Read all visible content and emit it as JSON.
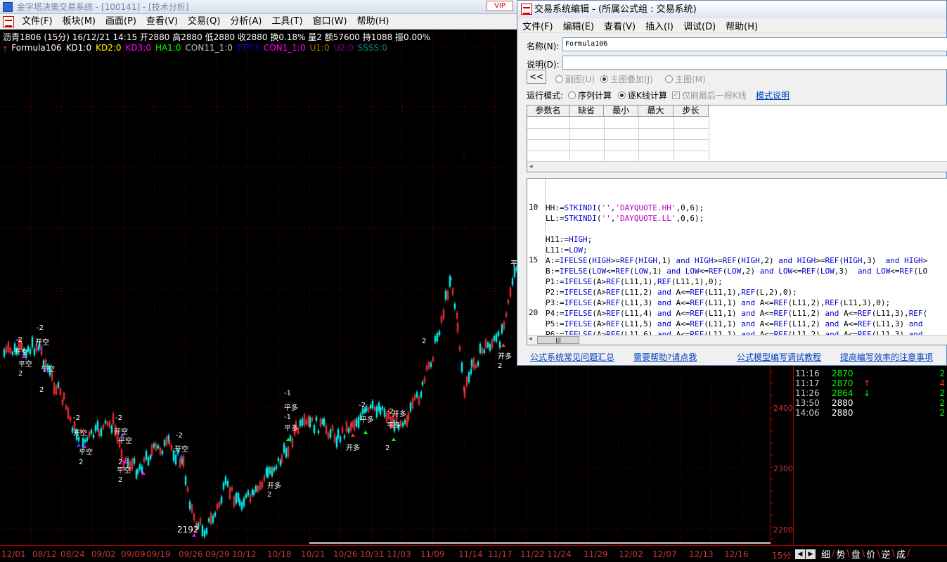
{
  "main_window": {
    "title": "金字塔决策交易系统 - [100141] - [技术分析]",
    "vip_badge": "VIP",
    "menu": [
      "文件(F)",
      "板块(M)",
      "画面(P)",
      "查看(V)",
      "交易(Q)",
      "分析(A)",
      "工具(T)",
      "窗口(W)",
      "帮助(H)"
    ]
  },
  "quote_info": "沥青1806 (15分) 16/12/21 14:15 开2880 高2880 低2880 收2880 换0.18% 量2 额57600 持1088 振0.00%",
  "indicator_bar": [
    {
      "text": "Formula106",
      "color": "#ffffff"
    },
    {
      "text": "KD1:0",
      "color": "#ffffff"
    },
    {
      "text": "KD2:0",
      "color": "#ffff00"
    },
    {
      "text": "KD3:0",
      "color": "#ff00ff"
    },
    {
      "text": "HA1:0",
      "color": "#00ff00"
    },
    {
      "text": "CON11_1:0",
      "color": "#c0c0c0"
    },
    {
      "text": "TTT:3",
      "color": "#0000ff"
    },
    {
      "text": "CON1_1:0",
      "color": "#ff00ff"
    },
    {
      "text": "U1:0",
      "color": "#808000"
    },
    {
      "text": "U2:0",
      "color": "#800080"
    },
    {
      "text": "SSSS:0",
      "color": "#008080"
    }
  ],
  "price_axis": [
    "2400",
    "2300",
    "2200"
  ],
  "date_axis": [
    "12/01",
    "08/12",
    "08/24",
    "09/02",
    "09/09",
    "09/19",
    "09/26",
    "09/29",
    "10/12",
    "10/18",
    "10/21",
    "10/26",
    "10/31",
    "11/03",
    "11/09",
    "11/14",
    "11/17",
    "11/22",
    "11/24",
    "11/29",
    "12/02",
    "12/07",
    "12/13",
    "12/16",
    "15分"
  ],
  "low_marker": "2192",
  "chart_annotations": [
    {
      "text": "-2",
      "color": "#ffffff"
    },
    {
      "text": "开空",
      "color": "#ffffff"
    },
    {
      "text": "平空",
      "color": "#ffffff"
    },
    {
      "text": "2",
      "color": "#ffffff"
    },
    {
      "text": "-2",
      "color": "#ffffff"
    },
    {
      "text": "开空",
      "color": "#ffffff"
    },
    {
      "text": "平空",
      "color": "#ffffff"
    },
    {
      "text": "2",
      "color": "#ffffff"
    },
    {
      "text": "-2",
      "color": "#ffffff"
    },
    {
      "text": "开空",
      "color": "#ffffff"
    },
    {
      "text": "平空",
      "color": "#ffffff"
    },
    {
      "text": "2",
      "color": "#ffffff"
    },
    {
      "text": "-2",
      "color": "#ffffff"
    },
    {
      "text": "开空",
      "color": "#ffffff"
    },
    {
      "text": "平空",
      "color": "#ffffff"
    },
    {
      "text": "2",
      "color": "#ffffff"
    },
    {
      "text": "平空",
      "color": "#ffffff"
    },
    {
      "text": "2",
      "color": "#ffffff"
    },
    {
      "text": "-2",
      "color": "#ffffff"
    },
    {
      "text": "开空",
      "color": "#ffffff"
    },
    {
      "text": "开多",
      "color": "#ffffff"
    },
    {
      "text": "2",
      "color": "#ffffff"
    },
    {
      "text": "-1",
      "color": "#ffffff"
    },
    {
      "text": "平多",
      "color": "#ffffff"
    },
    {
      "text": "-1",
      "color": "#ffffff"
    },
    {
      "text": "平多",
      "color": "#ffffff"
    },
    {
      "text": "开多",
      "color": "#ffffff"
    },
    {
      "text": "-2",
      "color": "#ffffff"
    },
    {
      "text": "平多",
      "color": "#ffffff"
    },
    {
      "text": "-2",
      "color": "#ffffff"
    },
    {
      "text": "平多",
      "color": "#ffffff"
    },
    {
      "text": "2",
      "color": "#ffffff"
    },
    {
      "text": "开多",
      "color": "#ffffff"
    },
    {
      "text": "2",
      "color": "#ffffff"
    },
    {
      "text": "开多",
      "color": "#ffffff"
    },
    {
      "text": "2",
      "color": "#ffffff"
    },
    {
      "text": "平",
      "color": "#ffffff"
    }
  ],
  "ticks": [
    {
      "time": "11:16",
      "price": "2870",
      "arrow": "",
      "vol": "2",
      "price_color": "#00ff00",
      "arrow_color": "#ffffff",
      "vol_color": "#00ff00"
    },
    {
      "time": "11:17",
      "price": "2870",
      "arrow": "↑",
      "vol": "4",
      "price_color": "#00ff00",
      "arrow_color": "#ff3333",
      "vol_color": "#ff3333"
    },
    {
      "time": "11:26",
      "price": "2864",
      "arrow": "↓",
      "vol": "2",
      "price_color": "#00ff00",
      "arrow_color": "#00ff00",
      "vol_color": "#00ff00"
    },
    {
      "time": "13:50",
      "price": "2880",
      "arrow": "",
      "vol": "2",
      "price_color": "#ffffff",
      "arrow_color": "#ffffff",
      "vol_color": "#00ff00"
    },
    {
      "time": "14:06",
      "price": "2880",
      "arrow": "",
      "vol": "2",
      "price_color": "#ffffff",
      "arrow_color": "#ffffff",
      "vol_color": "#00ff00"
    }
  ],
  "bottom_tabs": [
    "细",
    "势",
    "盘",
    "价",
    "逆",
    "成"
  ],
  "dialog": {
    "title": "交易系统编辑 - (所属公式组 : 交易系统)",
    "menu": [
      "文件(F)",
      "编辑(E)",
      "查看(V)",
      "插入(I)",
      "调试(D)",
      "帮助(H)"
    ],
    "name_label": "名称(N):",
    "name_value": "Formula106",
    "desc_label": "说明(D):",
    "desc_value": "",
    "collapse_label": "<<",
    "chart_options": [
      {
        "label": "副图(U)",
        "checked": false
      },
      {
        "label": "主图叠加(J)",
        "checked": true
      },
      {
        "label": "主图(M)",
        "checked": false
      }
    ],
    "run_mode_label": "运行模式:",
    "run_options": [
      {
        "label": "序列计算",
        "checked": false
      },
      {
        "label": "逐K线计算",
        "checked": true
      }
    ],
    "refresh_last_label": "仅刷最后一根K线",
    "mode_link": "模式说明",
    "param_headers": [
      "参数名",
      "缺省",
      "最小",
      "最大",
      "步长"
    ],
    "code_lines": [
      {
        "num": "",
        "text": ""
      },
      {
        "num": "",
        "text": ""
      },
      {
        "num": "10",
        "text": "HH:=STKINDI('','DAYQUOTE.HH',0,6);"
      },
      {
        "num": "",
        "text": "LL:=STKINDI('','DAYQUOTE.LL',0,6);"
      },
      {
        "num": "",
        "text": ""
      },
      {
        "num": "",
        "text": "H11:=HIGH;"
      },
      {
        "num": "",
        "text": "L11:=LOW;"
      },
      {
        "num": "15",
        "text": "A:=IFELSE(HIGH>=REF(HIGH,1) and HIGH>=REF(HIGH,2) and HIGH>=REF(HIGH,3)  and HIGH>"
      },
      {
        "num": "",
        "text": "B:=IFELSE(LOW<=REF(LOW,1) and LOW<=REF(LOW,2) and LOW<=REF(LOW,3)  and LOW<=REF(LO"
      },
      {
        "num": "",
        "text": "P1:=IFELSE(A>REF(L11,1),REF(L11,1),0);"
      },
      {
        "num": "",
        "text": "P2:=IFELSE(A>REF(L11,2) and A<=REF(L11,1),REF(L,2),0);"
      },
      {
        "num": "",
        "text": "P3:=IFELSE(A>REF(L11,3) and A<=REF(L11,1) and A<=REF(L11,2),REF(L11,3),0);"
      },
      {
        "num": "20",
        "text": "P4:=IFELSE(A>REF(L11,4) and A<=REF(L11,1) and A<=REF(L11,2) and A<=REF(L11,3),REF("
      },
      {
        "num": "",
        "text": "P5:=IFELSE(A>REF(L11,5) and A<=REF(L11,1) and A<=REF(L11,2) and A<=REF(L11,3) and"
      },
      {
        "num": "",
        "text": "P6:=IFELSE(A>REF(L11,6) and A<=REF(L11,1) and A<=REF(L11,2) and A<=REF(L11,3) and"
      }
    ],
    "links": [
      "公式系统常见问题汇总",
      "需要帮助?请点我",
      "公式模型编写调试教程",
      "提高编写效率的注意事项"
    ]
  },
  "colors": {
    "up": "#ff3333",
    "down": "#00e0e0",
    "grid": "#8a0000",
    "text_red": "#cc3333"
  }
}
